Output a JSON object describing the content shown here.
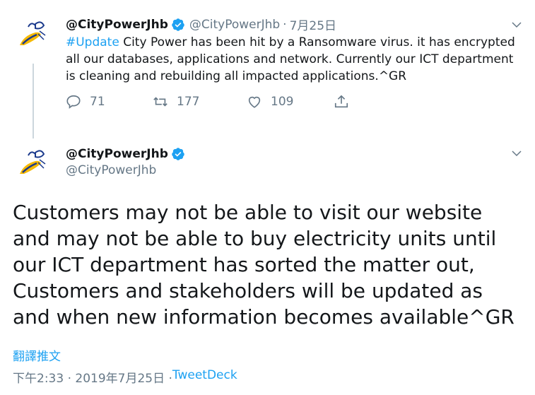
{
  "tweet1": {
    "display_name": "@CityPowerJhb",
    "handle": "@CityPowerJhb",
    "separator": "·",
    "date": "7月25日",
    "hashtag": "#Update",
    "text": " City Power has been hit by a Ransomware virus. it has encrypted all our databases, applications and network. Currently our ICT department is cleaning and rebuilding all impacted applications.^GR",
    "reply_count": "71",
    "retweet_count": "177",
    "like_count": "109",
    "icons": [
      "reply-icon",
      "retweet-icon",
      "like-icon",
      "share-icon",
      "verified-icon",
      "chevron-down-icon"
    ]
  },
  "tweet2": {
    "display_name": "@CityPowerJhb",
    "handle": "@CityPowerJhb",
    "text": "Customers may not be able to visit our website and may not be able to buy electricity units until our ICT department has sorted the matter out, Customers and stakeholders will be updated as and when new information becomes available^GR",
    "translate_label": "翻譯推文",
    "time": "下午2:33 · 2019年7月25日 · ",
    "source": "TweetDeck"
  },
  "colors": {
    "accent": "#1da1f2",
    "secondary_text": "#657786",
    "primary_text": "#14171a",
    "thread_line": "#ccd6dd"
  }
}
